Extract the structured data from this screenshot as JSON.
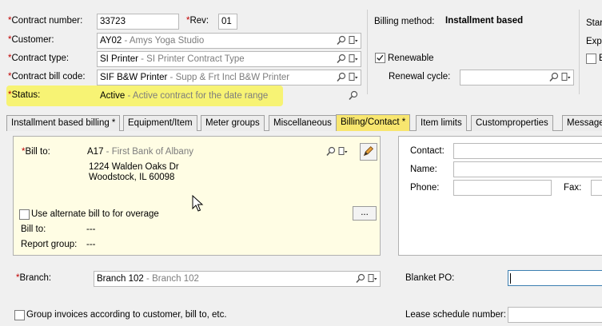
{
  "header": {
    "contract_number": {
      "label": "Contract number:",
      "value": "33723"
    },
    "rev": {
      "label": "Rev:",
      "value": "01"
    },
    "customer": {
      "label": "Customer:",
      "code": "AY02",
      "sep": " - ",
      "desc": "Amys Yoga Studio"
    },
    "contract_type": {
      "label": "Contract type:",
      "code": "SI Printer",
      "sep": " - ",
      "desc": "SI Printer Contract Type"
    },
    "contract_bill_code": {
      "label": "Contract bill code:",
      "code": "SIF B&W Printer",
      "sep": " - ",
      "desc": "Supp & Frt Incl B&W Printer"
    },
    "status": {
      "label": "Status:",
      "code": "Active",
      "sep": " - ",
      "desc": "Active contract for the date range"
    },
    "billing_method": {
      "label": "Billing method:",
      "value": "Installment based"
    },
    "renewable": {
      "label": "Renewable",
      "checked": true
    },
    "renewal_cycle": {
      "label": "Renewal cycle:",
      "value": ""
    },
    "right_cut": {
      "star": "Star",
      "expi": "Expi",
      "e": "E"
    },
    "required_mark": "*"
  },
  "tabs": [
    {
      "label": "Installment based billing *",
      "active": false
    },
    {
      "label": "Equipment/Item",
      "active": false
    },
    {
      "label": "Meter groups",
      "active": false
    },
    {
      "label": "Miscellaneous",
      "active": false
    },
    {
      "label": "Billing/Contact *",
      "active": true
    },
    {
      "label": "Item limits",
      "active": false
    },
    {
      "label": "Customproperties",
      "active": false
    },
    {
      "label": "Messages",
      "active": false
    }
  ],
  "billing": {
    "bill_to": {
      "label": "Bill to:",
      "code": "A17",
      "sep": " - ",
      "desc": "First Bank of Albany"
    },
    "address_line1": "1224 Walden Oaks Dr",
    "address_line2": "Woodstock, IL 60098",
    "alt_bill": {
      "label": "Use alternate bill to for overage",
      "checked": false
    },
    "ellipsis_button": "...",
    "bill_to_readonly": {
      "label": "Bill to:",
      "value": "---"
    },
    "report_group": {
      "label": "Report group:",
      "value": "---"
    }
  },
  "contact": {
    "contact_label": "Contact:",
    "name_label": "Name:",
    "phone_label": "Phone:",
    "fax_label": "Fax:"
  },
  "bottom": {
    "branch": {
      "label": "Branch:",
      "code": "Branch 102",
      "sep": " - ",
      "desc": "Branch 102"
    },
    "blanket_po": {
      "label": "Blanket PO:",
      "value": ""
    },
    "group_invoices": {
      "label": "Group invoices according to customer, bill to, etc.",
      "checked": false
    },
    "lease_schedule": {
      "label": "Lease schedule number:",
      "value": ""
    }
  },
  "icons": {
    "lookup": "magnifier-icon",
    "dropdown": "document-dropdown-icon",
    "edit": "pencil-icon",
    "cursor": "mouse-pointer-icon"
  },
  "colors": {
    "highlight": "#f7f374",
    "active_tab": "#f8e66f",
    "panel": "#fffde4",
    "required": "#c00000"
  }
}
